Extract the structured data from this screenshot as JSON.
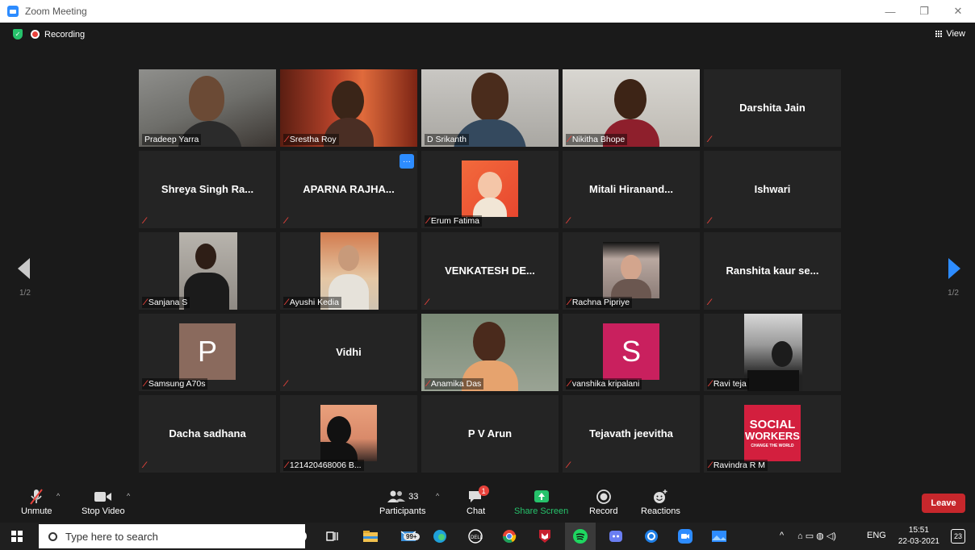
{
  "window": {
    "title": "Zoom Meeting",
    "controls": [
      "—",
      "❐",
      "✕"
    ]
  },
  "meeting": {
    "recording_label": "Recording",
    "view_label": "View",
    "page_left": "1/2",
    "page_right": "1/2"
  },
  "tiles": [
    {
      "name": "Pradeep Yarra",
      "muted": false,
      "kind": "video",
      "active": true
    },
    {
      "name": "Srestha Roy",
      "muted": true,
      "kind": "video"
    },
    {
      "name": "D Srikanth",
      "muted": false,
      "kind": "video"
    },
    {
      "name": "Nikitha Bhope",
      "muted": true,
      "kind": "video"
    },
    {
      "display": "Darshita Jain",
      "muted": true,
      "kind": "name"
    },
    {
      "display": "Shreya Singh Ra...",
      "muted": true,
      "kind": "name"
    },
    {
      "display": "APARNA RAJHA...",
      "muted": true,
      "kind": "name"
    },
    {
      "name": "Erum Fatima",
      "muted": true,
      "kind": "photo"
    },
    {
      "display": "Mitali  Hiranand...",
      "muted": true,
      "kind": "name"
    },
    {
      "display": "Ishwari",
      "muted": true,
      "kind": "name"
    },
    {
      "name": "Sanjana S",
      "muted": true,
      "kind": "photo"
    },
    {
      "name": "Ayushi Kedia",
      "muted": true,
      "kind": "photo"
    },
    {
      "display": "VENKATESH  DE...",
      "muted": true,
      "kind": "name"
    },
    {
      "name": "Rachna Pipriye",
      "muted": true,
      "kind": "photo"
    },
    {
      "display": "Ranshita kaur se...",
      "muted": true,
      "kind": "name"
    },
    {
      "name": "Samsung A70s",
      "muted": true,
      "kind": "initial",
      "initial": "P",
      "color": "#8a6a5d"
    },
    {
      "display": "Vidhi",
      "muted": true,
      "kind": "name"
    },
    {
      "name": "Anamika Das",
      "muted": true,
      "kind": "video"
    },
    {
      "name": "vanshika kripalani",
      "muted": true,
      "kind": "initial",
      "initial": "S",
      "color": "#c9205e"
    },
    {
      "name": "Ravi teja",
      "muted": true,
      "kind": "photo"
    },
    {
      "display": "Dacha sadhana",
      "muted": true,
      "kind": "name"
    },
    {
      "name": "121420468006 B...",
      "muted": true,
      "kind": "photo"
    },
    {
      "display": "P V Arun",
      "muted": false,
      "kind": "name"
    },
    {
      "display": "Tejavath jeevitha",
      "muted": true,
      "kind": "name"
    },
    {
      "name": "Ravindra R M",
      "muted": true,
      "kind": "logo",
      "logo_text": [
        "SOCIAL",
        "WORKERS",
        "CHANGE THE WORLD"
      ]
    }
  ],
  "toolbar": {
    "unmute": "Unmute",
    "stop_video": "Stop Video",
    "participants": "Participants",
    "participants_count": "33",
    "chat": "Chat",
    "chat_badge": "1",
    "share_screen": "Share Screen",
    "record": "Record",
    "reactions": "Reactions",
    "leave": "Leave"
  },
  "taskbar": {
    "search_placeholder": "Type here to search",
    "mail_badge": "99+",
    "lang": "ENG",
    "time": "15:51",
    "date": "22-03-2021",
    "notifications": "23"
  },
  "colors": {
    "accent": "#2d8cff",
    "active_speaker": "#c6ec5c",
    "mute": "#e8423b",
    "leave": "#c7272c",
    "share": "#26c26b"
  }
}
